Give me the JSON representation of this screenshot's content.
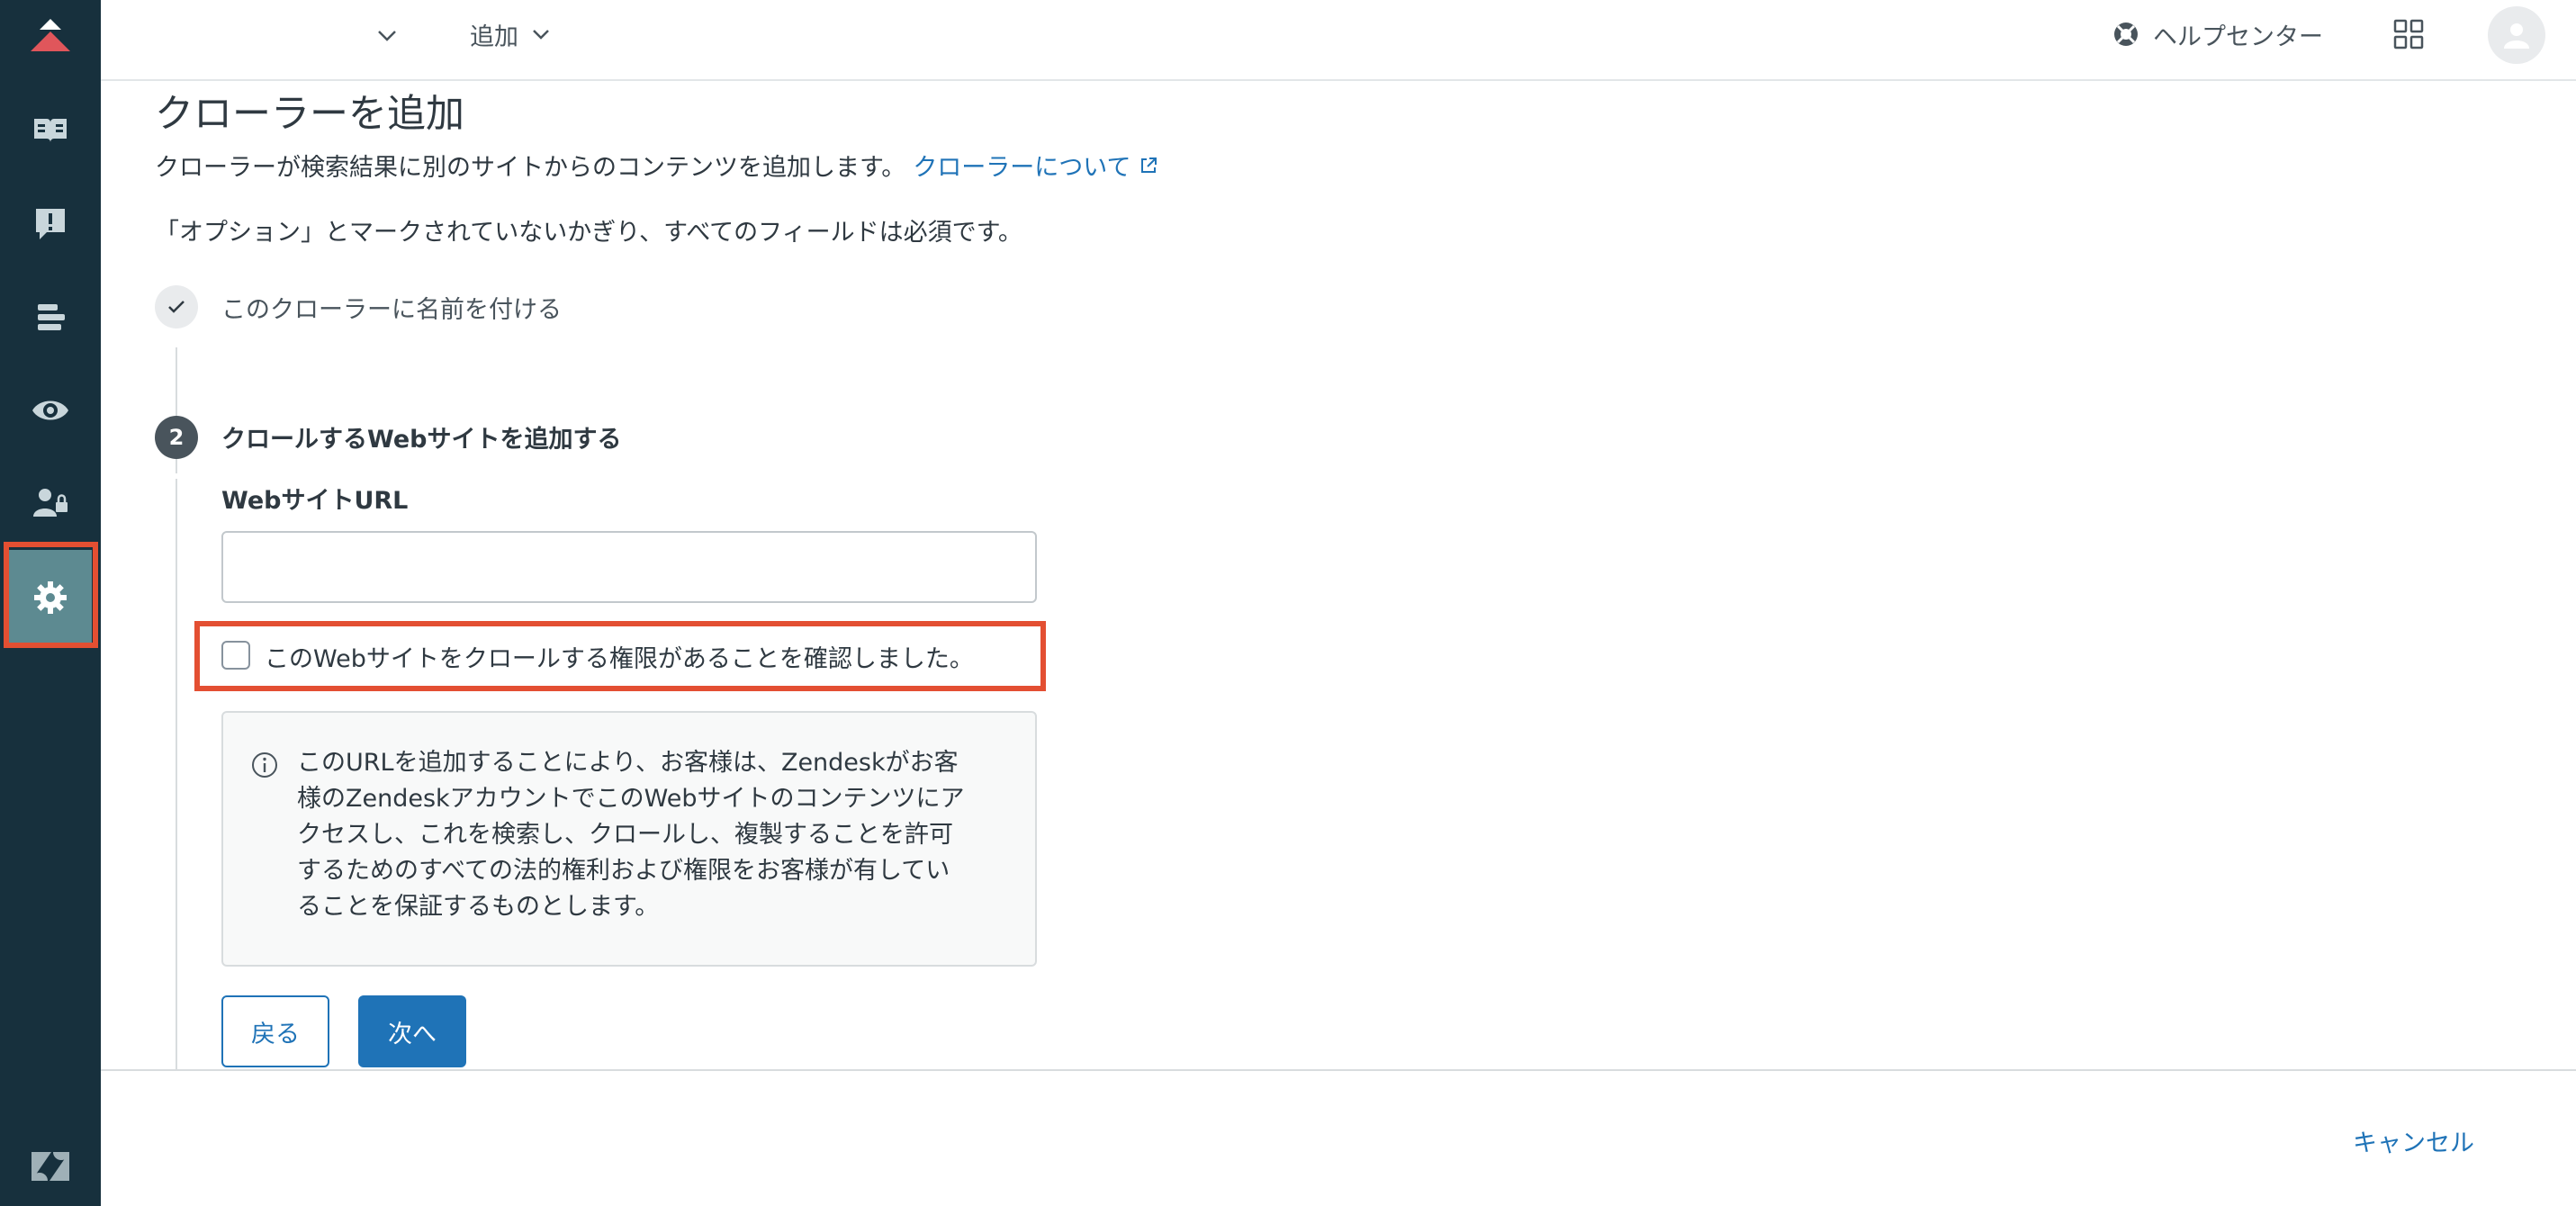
{
  "sidebar": {
    "items": [
      {
        "name": "guide-icon"
      },
      {
        "name": "alert-icon"
      },
      {
        "name": "list-icon"
      },
      {
        "name": "eye-icon"
      },
      {
        "name": "user-lock-icon"
      },
      {
        "name": "gear-icon",
        "active": true
      }
    ]
  },
  "topbar": {
    "add_label": "追加",
    "help_label": "ヘルプセンター"
  },
  "page": {
    "title": "クローラーを追加",
    "intro_text": "クローラーが検索結果に別のサイトからのコンテンツを追加します。",
    "intro_link": "クローラーについて",
    "required_note": "「オプション」とマークされていないかぎり、すべてのフィールドは必須です。"
  },
  "steps": {
    "step1_label": "このクローラーに名前を付ける",
    "step2_number": "2",
    "step2_label": "クロールするWebサイトを追加する"
  },
  "form": {
    "url_label": "WebサイトURL",
    "url_value": "",
    "confirm_label": "このWebサイトをクロールする権限があることを確認しました。",
    "confirm_checked": false,
    "info_text": "このURLを追加することにより、お客様は、Zendeskがお客様のZendeskアカウントでこのWebサイトのコンテンツにアクセスし、これを検索し、クロールし、複製することを許可するためのすべての法的権利および権限をお客様が有していることを保証するものとします。",
    "back_label": "戻る",
    "next_label": "次へ"
  },
  "footer": {
    "cancel_label": "キャンセル"
  },
  "colors": {
    "sidebar_bg": "#17303d",
    "sidebar_active": "#5d8a91",
    "highlight": "#e34f32",
    "primary": "#1f73b7",
    "logo_red": "#e0565b"
  }
}
